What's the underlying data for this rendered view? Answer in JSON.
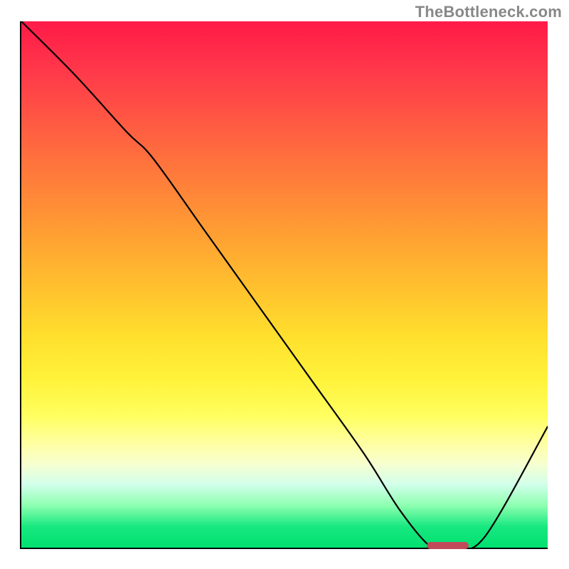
{
  "watermark": "TheBottleneck.com",
  "chart_data": {
    "type": "line",
    "title": "",
    "xlabel": "",
    "ylabel": "",
    "xlim": [
      0,
      100
    ],
    "ylim": [
      0,
      100
    ],
    "x": [
      0,
      10,
      20,
      25,
      35,
      45,
      55,
      65,
      72,
      78,
      82,
      88,
      100
    ],
    "values": [
      100,
      90,
      79,
      74,
      60,
      46,
      32,
      18,
      7,
      0,
      0,
      2,
      23
    ],
    "marker": {
      "x_start": 77,
      "x_end": 85,
      "y": 0,
      "color": "#c14a5a"
    },
    "gradient_stops": [
      {
        "pos": 0.0,
        "color": "#ff1a48"
      },
      {
        "pos": 0.5,
        "color": "#ffbf2e"
      },
      {
        "pos": 0.75,
        "color": "#ffff60"
      },
      {
        "pos": 1.0,
        "color": "#00e070"
      }
    ]
  }
}
